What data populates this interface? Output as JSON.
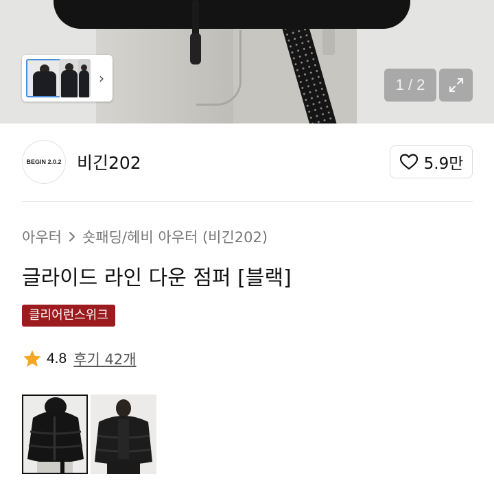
{
  "gallery": {
    "counter": "1 / 2",
    "thumbnail_strip_next": "›"
  },
  "brand": {
    "logo_text": "BEGIN 2.0.2",
    "name": "비긴202",
    "like_count": "5.9만"
  },
  "product": {
    "breadcrumb": [
      "아우터",
      "숏패딩/헤비 아우터 (비긴202)"
    ],
    "title": "글라이드 라인 다운 점퍼 [블랙]",
    "promo_badge": "클리어런스위크",
    "rating": "4.8",
    "review_link": "후기 42개"
  },
  "colors": {
    "accent_red": "#9b1b1f",
    "star": "#f5a623"
  },
  "icons": {
    "expand": "expand-icon",
    "heart": "heart-icon",
    "star": "star-icon",
    "breadcrumb_separator": "chevron-right-icon"
  }
}
